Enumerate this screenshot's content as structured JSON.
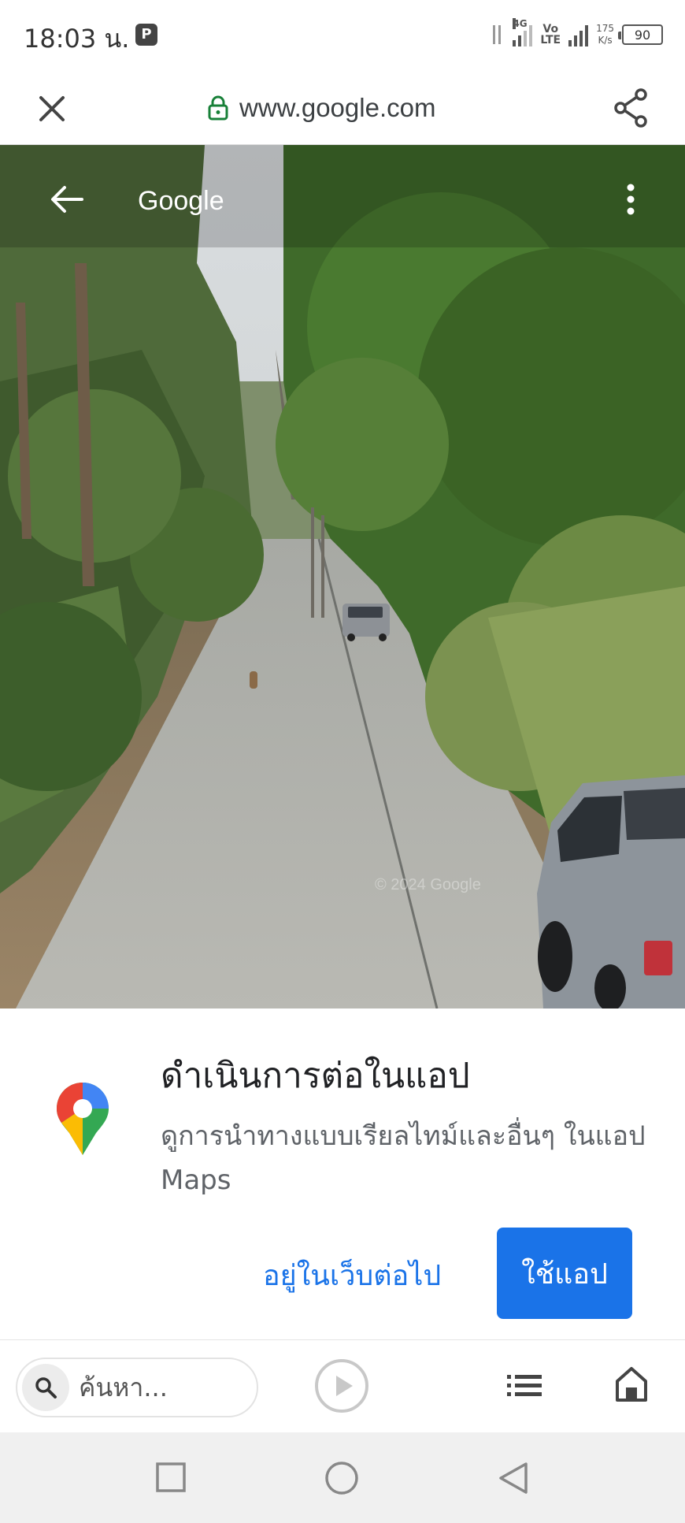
{
  "status_bar": {
    "time": "18:03 น.",
    "app_icon_letter": "P",
    "network_type": "4G",
    "volte_line1": "Vo",
    "volte_line2": "LTE",
    "speed_value": "175",
    "speed_unit": "K/s",
    "battery": "90"
  },
  "browser": {
    "url": "www.google.com",
    "icons": {
      "close": "close-icon",
      "lock": "lock-icon",
      "share": "share-icon"
    },
    "accent_color": "#1a73e8",
    "lock_color": "#188038"
  },
  "street_view": {
    "title": "Google",
    "copyright": "© 2024 Google",
    "icons": {
      "back": "arrow-back-icon",
      "menu": "more-vert-icon"
    }
  },
  "app_prompt": {
    "title": "ดำเนินการต่อในแอป",
    "description": "ดูการนำทางแบบเรียลไทม์และอื่นๆ ในแอป Maps",
    "stay_button": "อยู่ในเว็บต่อไป",
    "use_app_button": "ใช้แอป",
    "icon": "google-maps-pin-icon"
  },
  "toolbar": {
    "search_placeholder": "ค้นหา...",
    "icons": {
      "search": "search-icon",
      "play": "play-icon",
      "list": "list-icon",
      "home": "home-icon"
    }
  },
  "nav_bar": {
    "icons": {
      "recents": "recents-square-icon",
      "home": "home-circle-icon",
      "back": "back-triangle-icon"
    }
  }
}
